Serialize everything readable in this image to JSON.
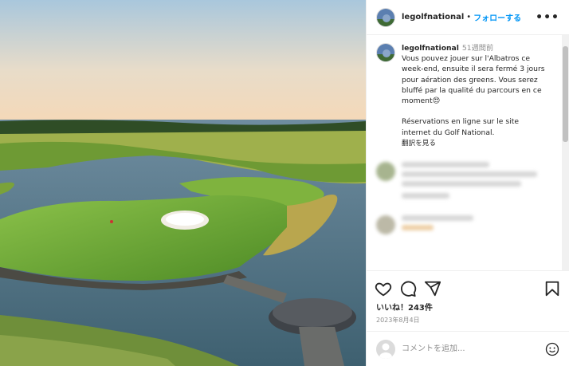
{
  "post": {
    "username": "legolfnational",
    "follow_separator": "•",
    "follow_label": "フォローする",
    "more_label": "•••"
  },
  "caption": {
    "username": "legolfnational",
    "time": "51週間前",
    "text": "Vous pouvez jouer sur l'Albatros ce week-end, ensuite il sera fermé 3 jours pour aération des greens. Vous serez bluffé par la qualité du parcours en ce moment😍\n\nRéservations en ligne sur le site internet du Golf National.",
    "translate_label": "翻訳を見る"
  },
  "icons": {
    "like": "heart-icon",
    "comment": "comment-icon",
    "share": "share-icon",
    "save": "bookmark-icon",
    "emoji": "emoji-icon",
    "more": "more-icon"
  },
  "stats": {
    "likes": "いいね！243件",
    "date": "2023年8月4日"
  },
  "comment_box": {
    "placeholder": "コメントを追加..."
  },
  "colors": {
    "follow": "#0095f6",
    "text": "#262626",
    "muted": "#8e8e8e"
  }
}
